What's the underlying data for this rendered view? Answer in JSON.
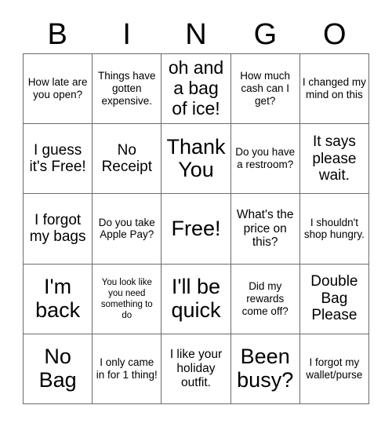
{
  "header": {
    "letters": [
      "B",
      "I",
      "N",
      "G",
      "O"
    ]
  },
  "grid": {
    "rows": 5,
    "columns": 5,
    "cells": [
      {
        "text": "How late are you open?",
        "size": "s"
      },
      {
        "text": "Things have gotten expensive.",
        "size": "s"
      },
      {
        "text": "oh and a bag of ice!",
        "size": "xl"
      },
      {
        "text": "How much cash can I get?",
        "size": "s"
      },
      {
        "text": "I changed my mind on this",
        "size": "s"
      },
      {
        "text": "I guess it's Free!",
        "size": "l"
      },
      {
        "text": "No Receipt",
        "size": "l"
      },
      {
        "text": "Thank You",
        "size": "xxl"
      },
      {
        "text": "Do you have a restroom?",
        "size": "s"
      },
      {
        "text": "It says please wait.",
        "size": "l"
      },
      {
        "text": "I forgot my bags",
        "size": "l"
      },
      {
        "text": "Do you take Apple Pay?",
        "size": "s"
      },
      {
        "text": "Free!",
        "size": "xxl"
      },
      {
        "text": "What's the price on this?",
        "size": "m"
      },
      {
        "text": "I shouldn't shop hungry.",
        "size": "s"
      },
      {
        "text": "I'm back",
        "size": "xxl"
      },
      {
        "text": "You look like you need something to do",
        "size": "xs"
      },
      {
        "text": "I'll be quick",
        "size": "xxl"
      },
      {
        "text": "Did my rewards come off?",
        "size": "s"
      },
      {
        "text": "Double Bag Please",
        "size": "l"
      },
      {
        "text": "No Bag",
        "size": "xxl"
      },
      {
        "text": "I only came in for 1 thing!",
        "size": "s"
      },
      {
        "text": "I like your holiday outfit.",
        "size": "m"
      },
      {
        "text": "Been busy?",
        "size": "xxl"
      },
      {
        "text": "I forgot my wallet/purse",
        "size": "s"
      }
    ]
  },
  "colors": {
    "background": "#ffffff",
    "text": "#000000",
    "border": "#6b6b6b"
  }
}
